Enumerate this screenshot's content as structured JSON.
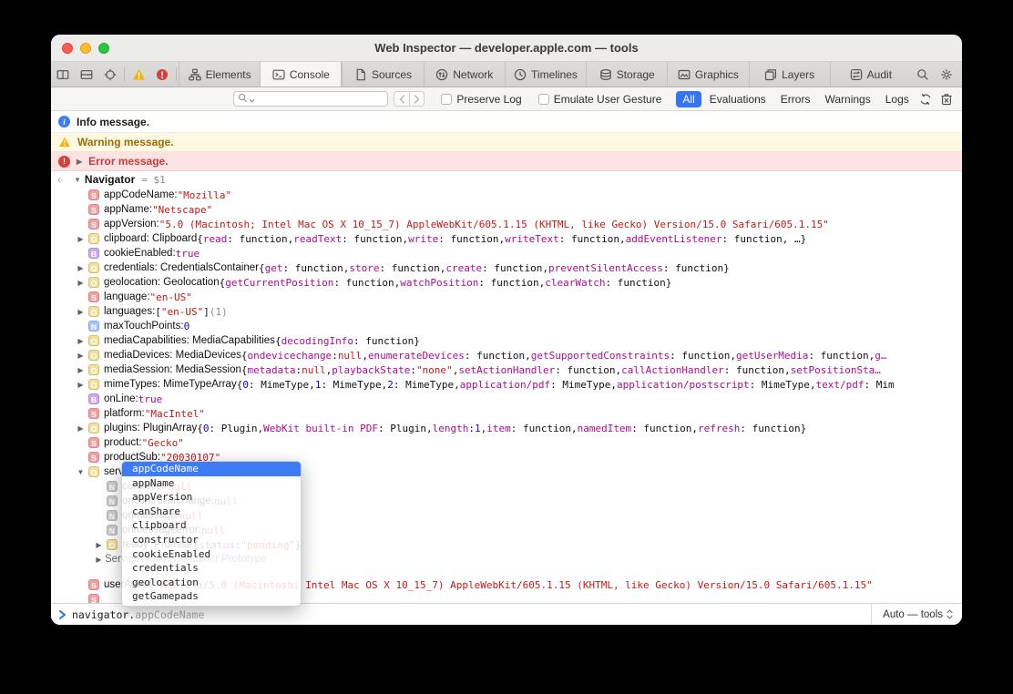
{
  "window": {
    "title": "Web Inspector — developer.apple.com — tools"
  },
  "colors": {
    "accent_blue": "#3575f2",
    "string_red": "#c41a16",
    "number_blue": "#1c00cf",
    "keyword_purple": "#a90d91",
    "warning_text": "#9e6b00",
    "error_text": "#c73b3b"
  },
  "toolbar": {
    "left_icons": [
      "dock-side-icon",
      "dock-bottom-icon",
      "element-picker-icon"
    ],
    "issue_icons": [
      "warning-badge-icon",
      "error-badge-icon"
    ],
    "tabs": [
      {
        "label": "Elements",
        "icon": "elements-icon",
        "active": false
      },
      {
        "label": "Console",
        "icon": "console-icon",
        "active": true
      },
      {
        "label": "Sources",
        "icon": "sources-icon",
        "active": false
      },
      {
        "label": "Network",
        "icon": "network-icon",
        "active": false
      },
      {
        "label": "Timelines",
        "icon": "timelines-icon",
        "active": false
      },
      {
        "label": "Storage",
        "icon": "storage-icon",
        "active": false
      },
      {
        "label": "Graphics",
        "icon": "graphics-icon",
        "active": false
      },
      {
        "label": "Layers",
        "icon": "layers-icon",
        "active": false
      },
      {
        "label": "Audit",
        "icon": "audit-icon",
        "active": false
      }
    ],
    "right_icons": [
      "search-icon",
      "gear-icon"
    ]
  },
  "filter_bar": {
    "search_placeholder": "",
    "checkboxes": [
      {
        "label": "Preserve Log",
        "checked": false
      },
      {
        "label": "Emulate User Gesture",
        "checked": false
      }
    ],
    "scopes": [
      {
        "label": "All",
        "active": true
      },
      {
        "label": "Evaluations",
        "active": false
      },
      {
        "label": "Errors",
        "active": false
      },
      {
        "label": "Warnings",
        "active": false
      },
      {
        "label": "Logs",
        "active": false
      }
    ],
    "right_icons": [
      "refresh-icon",
      "trash-icon"
    ]
  },
  "messages": [
    {
      "type": "info",
      "text": "Info message."
    },
    {
      "type": "warning",
      "text": "Warning message."
    },
    {
      "type": "error",
      "text": "Error message."
    }
  ],
  "result_header": {
    "name": "Navigator",
    "assignment": "= $1"
  },
  "tree_rows": [
    {
      "indent": 1,
      "arrow": null,
      "badge": "S",
      "segments": [
        {
          "text": "appCodeName: ",
          "style": "name"
        },
        {
          "text": "\"Mozilla\"",
          "style": "str"
        }
      ]
    },
    {
      "indent": 1,
      "arrow": null,
      "badge": "S",
      "segments": [
        {
          "text": "appName: ",
          "style": "name"
        },
        {
          "text": "\"Netscape\"",
          "style": "str"
        }
      ]
    },
    {
      "indent": 1,
      "arrow": null,
      "badge": "S",
      "segments": [
        {
          "text": "appVersion: ",
          "style": "name"
        },
        {
          "text": "\"5.0 (Macintosh; Intel Mac OS X 10_15_7) AppleWebKit/605.1.15 (KHTML, like Gecko) Version/15.0 Safari/605.1.15\"",
          "style": "str"
        }
      ]
    },
    {
      "indent": 1,
      "arrow": "right",
      "badge": "O",
      "segments": [
        {
          "text": "clipboard: Clipboard ",
          "style": "name"
        },
        {
          "text": "{",
          "style": "mono"
        },
        {
          "text": "read",
          "style": "kw"
        },
        {
          "text": ": function, ",
          "style": "mono"
        },
        {
          "text": "readText",
          "style": "kw"
        },
        {
          "text": ": function, ",
          "style": "mono"
        },
        {
          "text": "write",
          "style": "kw"
        },
        {
          "text": ": function, ",
          "style": "mono"
        },
        {
          "text": "writeText",
          "style": "kw"
        },
        {
          "text": ": function, ",
          "style": "mono"
        },
        {
          "text": "addEventListener",
          "style": "kw"
        },
        {
          "text": ": function, …}",
          "style": "mono"
        }
      ]
    },
    {
      "indent": 1,
      "arrow": null,
      "badge": "B",
      "segments": [
        {
          "text": "cookieEnabled: ",
          "style": "name"
        },
        {
          "text": "true",
          "style": "kw"
        }
      ]
    },
    {
      "indent": 1,
      "arrow": "right",
      "badge": "O",
      "segments": [
        {
          "text": "credentials: CredentialsContainer ",
          "style": "name"
        },
        {
          "text": "{",
          "style": "mono"
        },
        {
          "text": "get",
          "style": "kw"
        },
        {
          "text": ": function, ",
          "style": "mono"
        },
        {
          "text": "store",
          "style": "kw"
        },
        {
          "text": ": function, ",
          "style": "mono"
        },
        {
          "text": "create",
          "style": "kw"
        },
        {
          "text": ": function, ",
          "style": "mono"
        },
        {
          "text": "preventSilentAccess",
          "style": "kw"
        },
        {
          "text": ": function}",
          "style": "mono"
        }
      ]
    },
    {
      "indent": 1,
      "arrow": "right",
      "badge": "O",
      "segments": [
        {
          "text": "geolocation: Geolocation ",
          "style": "name"
        },
        {
          "text": "{",
          "style": "mono"
        },
        {
          "text": "getCurrentPosition",
          "style": "kw"
        },
        {
          "text": ": function, ",
          "style": "mono"
        },
        {
          "text": "watchPosition",
          "style": "kw"
        },
        {
          "text": ": function, ",
          "style": "mono"
        },
        {
          "text": "clearWatch",
          "style": "kw"
        },
        {
          "text": ": function}",
          "style": "mono"
        }
      ]
    },
    {
      "indent": 1,
      "arrow": null,
      "badge": "S",
      "segments": [
        {
          "text": "language: ",
          "style": "name"
        },
        {
          "text": "\"en-US\"",
          "style": "str"
        }
      ]
    },
    {
      "indent": 1,
      "arrow": "right",
      "badge": "O",
      "segments": [
        {
          "text": "languages: ",
          "style": "name"
        },
        {
          "text": "[",
          "style": "mono"
        },
        {
          "text": "\"en-US\"",
          "style": "str"
        },
        {
          "text": "]",
          "style": "mono"
        },
        {
          "text": " (1)",
          "style": "gray"
        }
      ]
    },
    {
      "indent": 1,
      "arrow": null,
      "badge": "N",
      "segments": [
        {
          "text": "maxTouchPoints: ",
          "style": "name"
        },
        {
          "text": "0",
          "style": "num"
        }
      ]
    },
    {
      "indent": 1,
      "arrow": "right",
      "badge": "O",
      "segments": [
        {
          "text": "mediaCapabilities: MediaCapabilities ",
          "style": "name"
        },
        {
          "text": "{",
          "style": "mono"
        },
        {
          "text": "decodingInfo",
          "style": "kw"
        },
        {
          "text": ": function}",
          "style": "mono"
        }
      ]
    },
    {
      "indent": 1,
      "arrow": "right",
      "badge": "O",
      "segments": [
        {
          "text": "mediaDevices: MediaDevices ",
          "style": "name"
        },
        {
          "text": "{",
          "style": "mono"
        },
        {
          "text": "ondevicechange",
          "style": "kw"
        },
        {
          "text": ": ",
          "style": "mono"
        },
        {
          "text": "null",
          "style": "nil"
        },
        {
          "text": ", ",
          "style": "mono"
        },
        {
          "text": "enumerateDevices",
          "style": "kw"
        },
        {
          "text": ": function, ",
          "style": "mono"
        },
        {
          "text": "getSupportedConstraints",
          "style": "kw"
        },
        {
          "text": ": function, ",
          "style": "mono"
        },
        {
          "text": "getUserMedia",
          "style": "kw"
        },
        {
          "text": ": function, ",
          "style": "mono"
        },
        {
          "text": "g…",
          "style": "kw"
        }
      ]
    },
    {
      "indent": 1,
      "arrow": "right",
      "badge": "O",
      "segments": [
        {
          "text": "mediaSession: MediaSession ",
          "style": "name"
        },
        {
          "text": "{",
          "style": "mono"
        },
        {
          "text": "metadata",
          "style": "kw"
        },
        {
          "text": ": ",
          "style": "mono"
        },
        {
          "text": "null",
          "style": "nil"
        },
        {
          "text": ", ",
          "style": "mono"
        },
        {
          "text": "playbackState",
          "style": "kw"
        },
        {
          "text": ": ",
          "style": "mono"
        },
        {
          "text": "\"none\"",
          "style": "str"
        },
        {
          "text": ", ",
          "style": "mono"
        },
        {
          "text": "setActionHandler",
          "style": "kw"
        },
        {
          "text": ": function, ",
          "style": "mono"
        },
        {
          "text": "callActionHandler",
          "style": "kw"
        },
        {
          "text": ": function, ",
          "style": "mono"
        },
        {
          "text": "setPositionSta…",
          "style": "kw"
        }
      ]
    },
    {
      "indent": 1,
      "arrow": "right",
      "badge": "O",
      "segments": [
        {
          "text": "mimeTypes: MimeTypeArray ",
          "style": "name"
        },
        {
          "text": "{",
          "style": "mono"
        },
        {
          "text": "0",
          "style": "num"
        },
        {
          "text": ": MimeType, ",
          "style": "mono"
        },
        {
          "text": "1",
          "style": "num"
        },
        {
          "text": ": MimeType, ",
          "style": "mono"
        },
        {
          "text": "2",
          "style": "num"
        },
        {
          "text": ": MimeType, ",
          "style": "mono"
        },
        {
          "text": "application/pdf",
          "style": "kw"
        },
        {
          "text": ": MimeType, ",
          "style": "mono"
        },
        {
          "text": "application/postscript",
          "style": "kw"
        },
        {
          "text": ": MimeType, ",
          "style": "mono"
        },
        {
          "text": "text/pdf",
          "style": "kw"
        },
        {
          "text": ": Mim",
          "style": "mono"
        }
      ]
    },
    {
      "indent": 1,
      "arrow": null,
      "badge": "B",
      "segments": [
        {
          "text": "onLine: ",
          "style": "name"
        },
        {
          "text": "true",
          "style": "kw"
        }
      ]
    },
    {
      "indent": 1,
      "arrow": null,
      "badge": "S",
      "segments": [
        {
          "text": "platform: ",
          "style": "name"
        },
        {
          "text": "\"MacIntel\"",
          "style": "str"
        }
      ]
    },
    {
      "indent": 1,
      "arrow": "right",
      "badge": "O",
      "segments": [
        {
          "text": "plugins: PluginArray ",
          "style": "name"
        },
        {
          "text": "{",
          "style": "mono"
        },
        {
          "text": "0",
          "style": "num"
        },
        {
          "text": ": Plugin, ",
          "style": "mono"
        },
        {
          "text": "WebKit built-in PDF",
          "style": "kw"
        },
        {
          "text": ": Plugin, ",
          "style": "mono"
        },
        {
          "text": "length",
          "style": "kw"
        },
        {
          "text": ": ",
          "style": "mono"
        },
        {
          "text": "1",
          "style": "num"
        },
        {
          "text": ", ",
          "style": "mono"
        },
        {
          "text": "item",
          "style": "kw"
        },
        {
          "text": ": function, ",
          "style": "mono"
        },
        {
          "text": "namedItem",
          "style": "kw"
        },
        {
          "text": ": function, ",
          "style": "mono"
        },
        {
          "text": "refresh",
          "style": "kw"
        },
        {
          "text": ": function}",
          "style": "mono"
        }
      ]
    },
    {
      "indent": 1,
      "arrow": null,
      "badge": "S",
      "segments": [
        {
          "text": "product: ",
          "style": "name"
        },
        {
          "text": "\"Gecko\"",
          "style": "str"
        }
      ]
    },
    {
      "indent": 1,
      "arrow": null,
      "badge": "S",
      "segments": [
        {
          "text": "productSub: ",
          "style": "name"
        },
        {
          "text": "\"20030107\"",
          "style": "str"
        }
      ]
    },
    {
      "indent": 1,
      "arrow": "down",
      "badge": "O",
      "segments": [
        {
          "text": "serviceWorker: ServiceWorkerContainer",
          "style": "name"
        }
      ]
    },
    {
      "indent": 2,
      "arrow": null,
      "badge": "N2",
      "segments": [
        {
          "text": "controller: ",
          "style": "name"
        },
        {
          "text": "null",
          "style": "nil"
        }
      ]
    },
    {
      "indent": 2,
      "arrow": null,
      "badge": "N2",
      "segments": [
        {
          "text": "oncontrollerchange: ",
          "style": "name"
        },
        {
          "text": "null",
          "style": "nil"
        }
      ]
    },
    {
      "indent": 2,
      "arrow": null,
      "badge": "N2",
      "segments": [
        {
          "text": "onmessage: ",
          "style": "name"
        },
        {
          "text": "null",
          "style": "nil"
        }
      ]
    },
    {
      "indent": 2,
      "arrow": null,
      "badge": "N2",
      "segments": [
        {
          "text": "onmessageerror: ",
          "style": "name"
        },
        {
          "text": "null",
          "style": "nil"
        }
      ]
    },
    {
      "indent": 2,
      "arrow": "right",
      "badge": "O",
      "segments": [
        {
          "text": "ready: Promise ",
          "style": "name"
        },
        {
          "text": "{",
          "style": "mono"
        },
        {
          "text": "status",
          "style": "kw"
        },
        {
          "text": ": ",
          "style": "mono"
        },
        {
          "text": "\"pending\"",
          "style": "str"
        },
        {
          "text": "}",
          "style": "mono"
        }
      ]
    },
    {
      "indent": 2,
      "arrow": "right",
      "badge": null,
      "segments": [
        {
          "text": "ServiceWorkerContainer Prototype",
          "style": "proto"
        }
      ]
    },
    {
      "indent": 1,
      "arrow": null,
      "badge": "S",
      "gap": 12,
      "segments": [
        {
          "text": "userAgent: ",
          "style": "name"
        },
        {
          "text": "\"Mozilla/5.0 (Macintosh; Intel Mac OS X 10_15_7) AppleWebKit/605.1.15 (KHTML, like Gecko) Version/15.0 Safari/605.1.15\"",
          "style": "str"
        }
      ]
    },
    {
      "indent": 1,
      "arrow": null,
      "badge": "S",
      "segments": []
    }
  ],
  "autocomplete": {
    "selected_index": 0,
    "items": [
      "appCodeName",
      "appName",
      "appVersion",
      "canShare",
      "clipboard",
      "constructor",
      "cookieEnabled",
      "credentials",
      "geolocation",
      "getGamepads"
    ]
  },
  "prompt": {
    "typed": "navigator.",
    "suggestion": "appCodeName"
  },
  "context_selector": {
    "label": "Auto — tools"
  }
}
